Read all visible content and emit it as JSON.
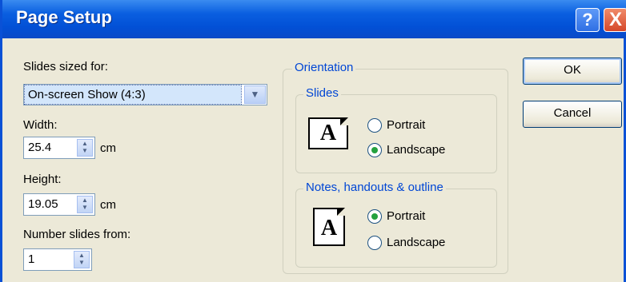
{
  "window": {
    "title": "Page Setup",
    "help_label": "?",
    "close_label": "X"
  },
  "size": {
    "slides_sized_for_label": "Slides sized for:",
    "slides_sized_for_value": "On-screen Show (4:3)",
    "width_label": "Width:",
    "width_value": "25.4",
    "height_label": "Height:",
    "height_value": "19.05",
    "unit": "cm",
    "number_from_label": "Number slides from:",
    "number_from_value": "1"
  },
  "orientation": {
    "group_label": "Orientation",
    "slides": {
      "label": "Slides",
      "portrait": "Portrait",
      "landscape": "Landscape",
      "selected": "Landscape"
    },
    "notes": {
      "label": "Notes, handouts & outline",
      "portrait": "Portrait",
      "landscape": "Landscape",
      "selected": "Portrait"
    },
    "icon_letter": "A"
  },
  "buttons": {
    "ok": "OK",
    "cancel": "Cancel"
  }
}
